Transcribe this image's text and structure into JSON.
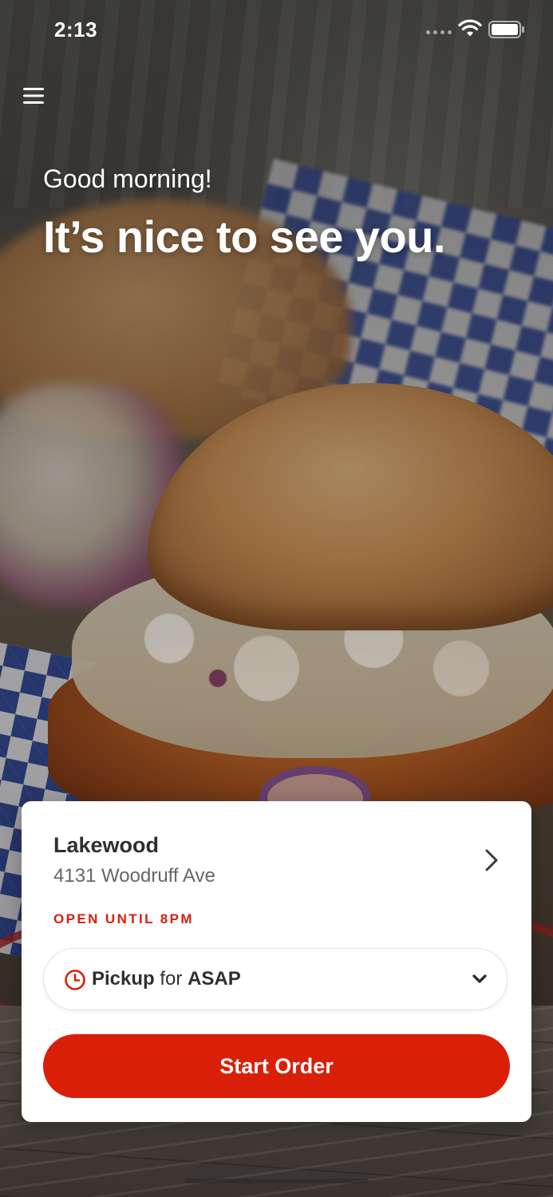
{
  "status_bar": {
    "time": "2:13",
    "icons": [
      "cellular-signal-icon",
      "wifi-icon",
      "battery-icon"
    ]
  },
  "header": {
    "menu_icon": "hamburger-menu-icon"
  },
  "hero": {
    "greeting": "Good morning!",
    "headline": "It’s nice to see you."
  },
  "location": {
    "name": "Lakewood",
    "address": "4131 Woodruff Ave",
    "status": "OPEN UNTIL 8PM",
    "chevron_icon": "chevron-right-icon"
  },
  "order_mode": {
    "icon": "clock-icon",
    "mode": "Pickup",
    "connector": "for",
    "time": "ASAP",
    "dropdown_icon": "chevron-down-icon"
  },
  "actions": {
    "start_order": "Start Order"
  },
  "colors": {
    "accent": "#d91f07",
    "status_text": "#d81f0c",
    "card_background": "#ffffff",
    "primary_text": "#2f2f2f",
    "secondary_text": "#666666"
  }
}
